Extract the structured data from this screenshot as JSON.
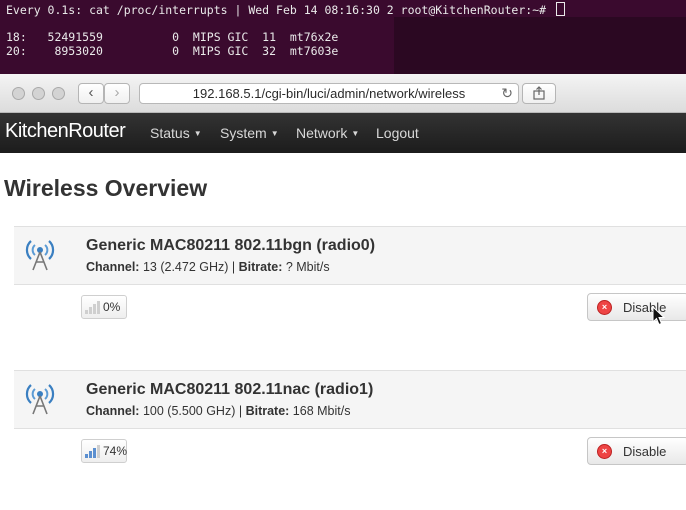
{
  "terminal": {
    "header": "Every 0.1s: cat /proc/interrupts | Wed Feb 14 08:16:30 2 root@KitchenRouter:~# ",
    "rows": [
      "18:   52491559          0  MIPS GIC  11  mt76x2e",
      "20:    8953020          0  MIPS GIC  32  mt7603e"
    ]
  },
  "browser": {
    "url": "192.168.5.1/cgi-bin/luci/admin/network/wireless",
    "back_icon": "chevron-left-icon",
    "forward_icon": "chevron-right-icon",
    "reload_icon": "reload-icon",
    "share_icon": "share-icon"
  },
  "navbar": {
    "brand": "KitchenRouter",
    "items": [
      {
        "label": "Status"
      },
      {
        "label": "System"
      },
      {
        "label": "Network"
      },
      {
        "label": "Logout"
      }
    ]
  },
  "page": {
    "title": "Wireless Overview"
  },
  "radios": [
    {
      "name": "Generic MAC80211 802.11bgn (radio0)",
      "channel_label": "Channel:",
      "channel_value": " 13 (2.472 GHz) | ",
      "bitrate_label": "Bitrate:",
      "bitrate_value": " ? Mbit/s",
      "signal": "0%",
      "signal_fraction": 0.0,
      "button": "Disable"
    },
    {
      "name": "Generic MAC80211 802.11nac (radio1)",
      "channel_label": "Channel:",
      "channel_value": " 100 (5.500 GHz) | ",
      "bitrate_label": "Bitrate:",
      "bitrate_value": " 168 Mbit/s",
      "signal": "74%",
      "signal_fraction": 0.74,
      "button": "Disable"
    }
  ],
  "colors": {
    "terminal_bg": "#3a0a2e",
    "navbar_bg": "#222222",
    "antenna_blue": "#3a7fc1",
    "signal_active": "#5b8fd0",
    "signal_inactive": "#cfcfcf",
    "disable_red": "#e44444"
  }
}
